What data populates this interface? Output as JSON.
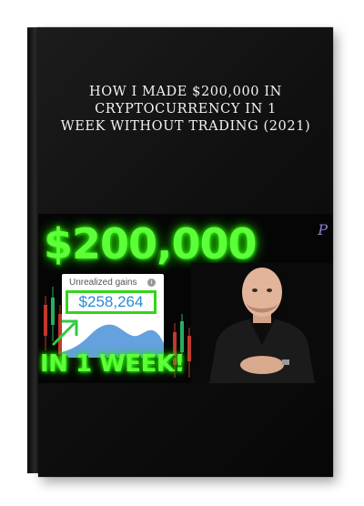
{
  "product": {
    "title_lines": [
      "HOW I MADE $200,000 IN",
      "CRYPTOCURRENCY IN 1",
      "WEEK WITHOUT TRADING (2021)"
    ]
  },
  "thumbnail": {
    "headline_amount": "$200,000",
    "bottom_text": "IN 1 WEEK!",
    "corner_mark": "P",
    "gains_card": {
      "label": "Unrealized gains",
      "info_symbol": "i",
      "value": "$258,264"
    }
  },
  "colors": {
    "box": "#101010",
    "title_text": "#f2f2f2",
    "neon_green": "#5cff3a",
    "value_blue": "#2a8bd6",
    "frame_green": "#33d51a"
  }
}
